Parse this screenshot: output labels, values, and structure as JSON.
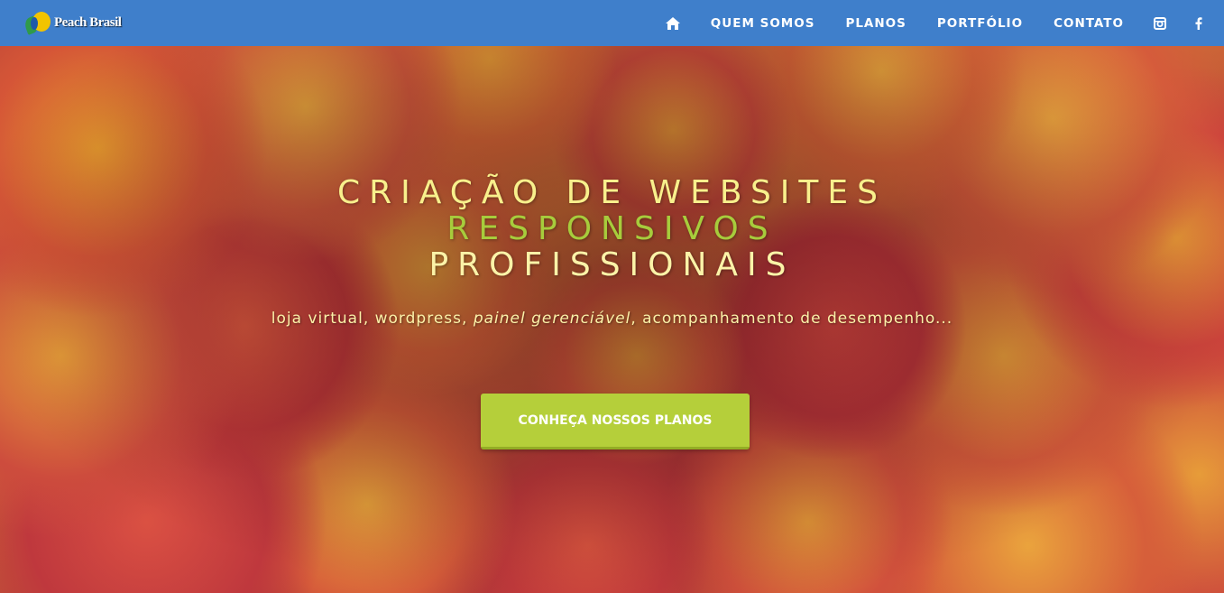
{
  "colors": {
    "navbar": "#3f7fcb",
    "headline_primary": "#f8f08c",
    "headline_accent": "#a7cc3c",
    "cta_background": "#b5cf3a"
  },
  "brand": {
    "name": "Peach Brasil",
    "logo_icon": "peach-brasil-logo"
  },
  "nav": {
    "home_icon": "home-icon",
    "quem_somos": "QUEM SOMOS",
    "planos": "PLANOS",
    "portfolio": "PORTFÓLIO",
    "contato": "CONTATO",
    "instagram_icon": "instagram-icon",
    "facebook_icon": "facebook-icon"
  },
  "hero": {
    "line1": "CRIAÇÃO DE WEBSITES",
    "line2": "RESPONSIVOS",
    "line3": "PROFISSIONAIS",
    "subline_part1": "loja virtual, wordpress, ",
    "subline_italic": "painel gerenciável",
    "subline_part2": ", acompanhamento de desempenho...",
    "cta_label": "CONHEÇA NOSSOS PLANOS"
  }
}
